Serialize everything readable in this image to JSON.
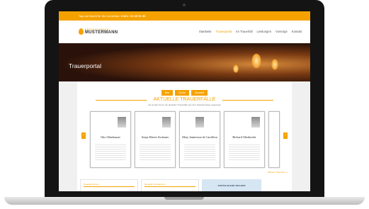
{
  "topbar": {
    "text": "Tag und Nacht für Sie erreichbar:",
    "phone": "0 821 / 23 49 91 00"
  },
  "logo": {
    "small": "BESTATTUNGEN",
    "big": "MUSTERMANN"
  },
  "nav": [
    "Startseite",
    "Trauerportal",
    "Im Trauerfall",
    "Leistungen",
    "Vorsorge",
    "Kontakt"
  ],
  "nav_active_index": 1,
  "hero": {
    "title": "Trauerportal"
  },
  "filters": [
    "Neu",
    "Suche",
    "Auswahl"
  ],
  "section": {
    "title": "AKTUELLE TRAUERFÄLLE",
    "subtitle": "Es werden Ihnen die aktuellen Trauerfälle aus dem Tagesanzeiger angezeigt"
  },
  "cards": [
    {
      "name": "Otto Oberhauser"
    },
    {
      "name": "Sonja Dierer-Asshauer"
    },
    {
      "name": "Mary Jamiesson de Carolfton"
    },
    {
      "name": "Richard Oberbrecht"
    }
  ],
  "more_link": "Weitere Traueranz. »",
  "boxes": [
    "Neueste Kerzen",
    "Neueste Kondolenzen",
    "ZURÜCK BLEIBT EIN HERZ"
  ],
  "colors": {
    "accent": "#f5a200",
    "dark": "#141414",
    "info_box": "#d6e6f3"
  }
}
